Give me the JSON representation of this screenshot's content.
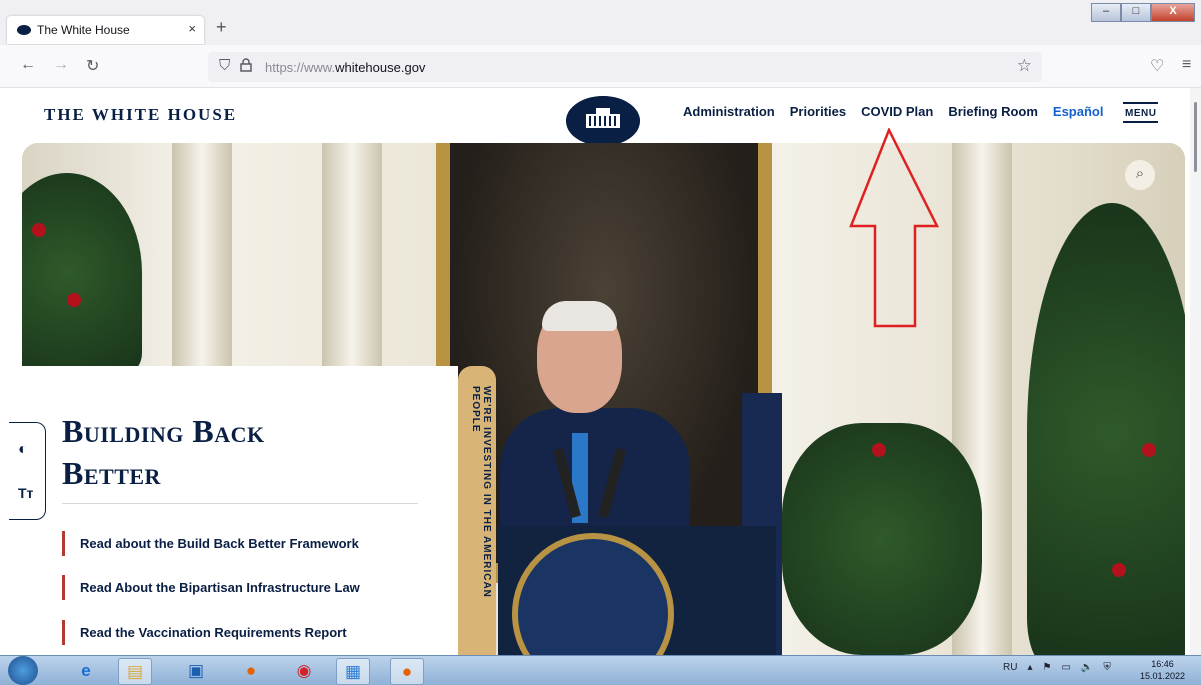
{
  "browser": {
    "tab_title": "The White House",
    "tab_close": "×",
    "new_tab": "+",
    "url_prefix": "https://www.",
    "url_host": "whitehouse.gov",
    "window_buttons": [
      "–",
      "□",
      "X"
    ]
  },
  "site": {
    "title": "THE WHITE HOUSE",
    "nav": [
      "Administration",
      "Priorities",
      "COVID Plan",
      "Briefing Room",
      "Español"
    ],
    "menu_label": "MENU"
  },
  "hero": {
    "heading_line1": "Building Back",
    "heading_line2": "Better",
    "links": [
      "Read about the Build Back Better Framework",
      "Read About the Bipartisan Infrastructure Law",
      "Read the Vaccination Requirements Report"
    ],
    "vertical_text": "WE'RE INVESTING IN THE AMERICAN PEOPLE"
  },
  "a11y": {
    "contrast_icon": "◐",
    "text_size_icon": "Tт"
  },
  "taskbar": {
    "language": "RU",
    "time": "16:46",
    "date": "15.01.2022"
  }
}
